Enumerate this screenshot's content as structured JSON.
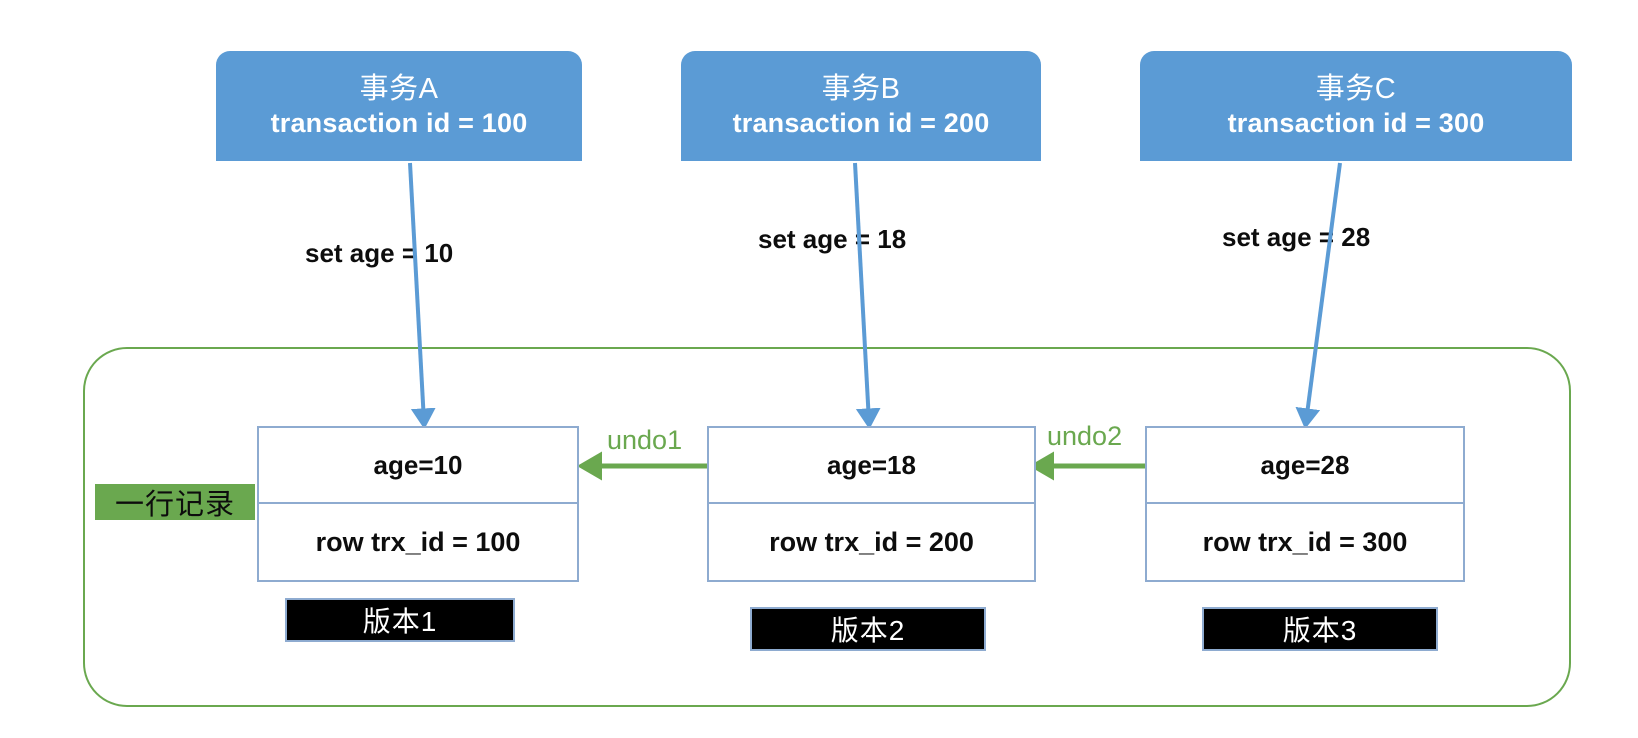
{
  "diagram": {
    "title_concept": "MySQL InnoDB MVCC undo log version chain",
    "accent_blue": "#5b9bd5",
    "accent_green": "#6aa84f",
    "border_blue": "#8eabd0",
    "chip_bg": "#000000"
  },
  "transactions": [
    {
      "name": "事务A",
      "id_label": "transaction id = 100",
      "action": "set age = 10"
    },
    {
      "name": "事务B",
      "id_label": "transaction id = 200",
      "action": "set age = 18"
    },
    {
      "name": "事务C",
      "id_label": "transaction id = 300",
      "action": "set age = 28"
    }
  ],
  "row_record": {
    "tag": "一行记录"
  },
  "versions": [
    {
      "age": "age=10",
      "trx": "row trx_id = 100",
      "chip": "版本1"
    },
    {
      "age": "age=18",
      "trx": "row trx_id = 200",
      "chip": "版本2"
    },
    {
      "age": "age=28",
      "trx": "row trx_id = 300",
      "chip": "版本3"
    }
  ],
  "undo_links": [
    {
      "label": "undo1"
    },
    {
      "label": "undo2"
    }
  ]
}
